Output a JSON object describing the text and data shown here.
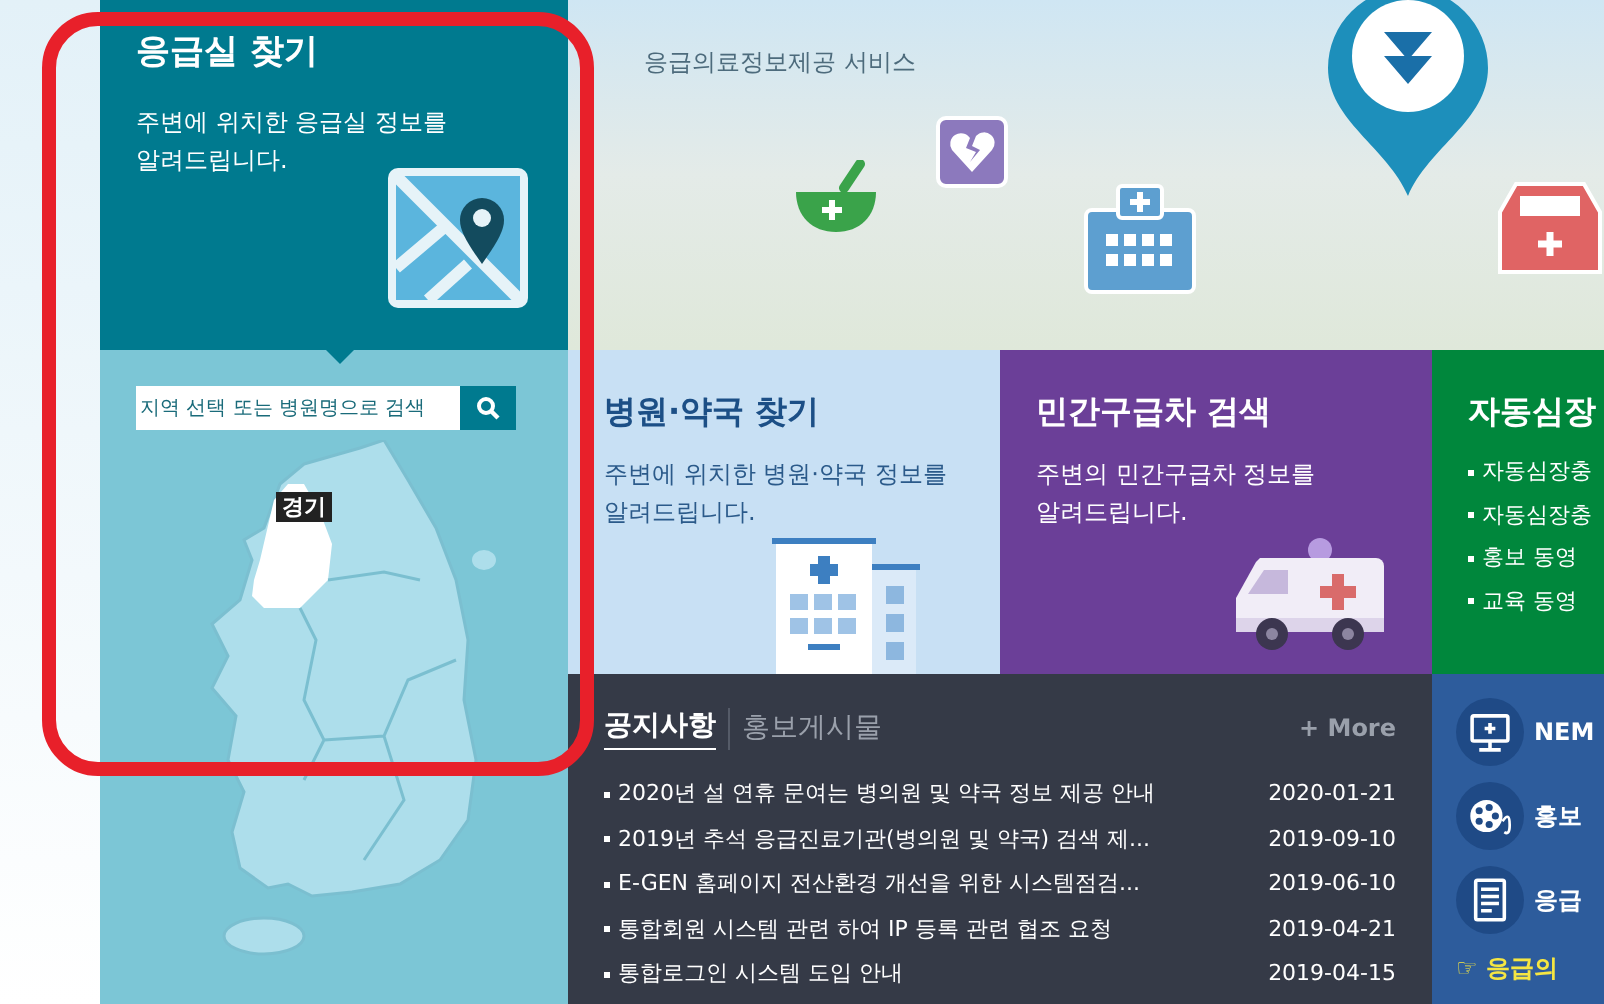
{
  "header": {
    "subtitle": "응급의료정보제공 서비스"
  },
  "er_finder": {
    "title": "응급실 찾기",
    "description": "주변에 위치한 응급실 정보를\n알려드립니다.",
    "search": {
      "placeholder": "지역 선택 또는 병원명으로 검색"
    },
    "region_label": "경기"
  },
  "cards": [
    {
      "kind": "hospital",
      "title": "병원·약국 찾기",
      "description": "주변에 위치한 병원·약국 정보를\n알려드립니다."
    },
    {
      "kind": "ambulance",
      "title": "민간구급차 검색",
      "description": "주변의 민간구급차 정보를\n알려드립니다."
    },
    {
      "kind": "aed",
      "title": "자동심장",
      "items": [
        "자동심장충",
        "자동심장충",
        "홍보 동영",
        "교육 동영"
      ]
    }
  ],
  "board": {
    "tabs": [
      {
        "label": "공지사항",
        "selected": true
      },
      {
        "label": "홍보게시물",
        "selected": false
      }
    ],
    "more": "+ More",
    "notices": [
      {
        "title": "2020년 설 연휴 문여는 병의원 및 약국 정보 제공 안내",
        "date": "2020-01-21"
      },
      {
        "title": "2019년 추석 응급진료기관(병의원 및 약국) 검색 제...",
        "date": "2019-09-10"
      },
      {
        "title": "E-GEN 홈페이지 전산환경 개선을 위한 시스템점검...",
        "date": "2019-06-10"
      },
      {
        "title": "통합회원 시스템 관련 하여 IP 등록 관련 협조 요청",
        "date": "2019-04-21"
      },
      {
        "title": "통합로그인 시스템 도입 안내",
        "date": "2019-04-15"
      }
    ]
  },
  "quick_links": [
    {
      "kind": "monitor",
      "label": "NEM"
    },
    {
      "kind": "film",
      "label": "홍보"
    },
    {
      "kind": "document",
      "label": "응급"
    }
  ],
  "quick_footer": "☞ 응급의"
}
